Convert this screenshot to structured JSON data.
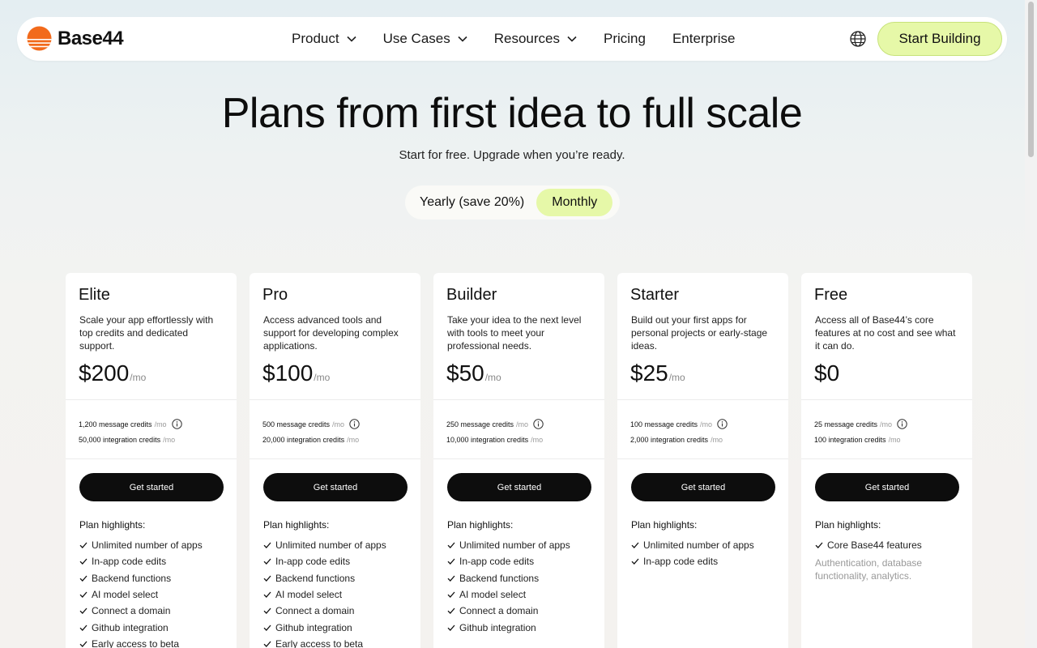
{
  "nav": {
    "brand": "Base44",
    "links": [
      {
        "label": "Product",
        "dropdown": true
      },
      {
        "label": "Use Cases",
        "dropdown": true
      },
      {
        "label": "Resources",
        "dropdown": true
      },
      {
        "label": "Pricing",
        "dropdown": false
      },
      {
        "label": "Enterprise",
        "dropdown": false
      }
    ],
    "cta": "Start Building",
    "cta_color": "#e6f8a8",
    "brand_color": "#f26a1b"
  },
  "hero": {
    "title": "Plans from first idea to full scale",
    "subtitle": "Start for free. Upgrade when you’re ready."
  },
  "billing_toggle": {
    "options": [
      "Yearly (save 20%)",
      "Monthly"
    ],
    "selected": "Monthly"
  },
  "plans": [
    {
      "name": "Elite",
      "description": "Scale your app effortlessly with top credits and dedicated support.",
      "price": "$200",
      "price_unit": "/mo",
      "message_credits": "1,200 message credits",
      "integration_credits": "50,000 integration credits",
      "credit_unit": "/mo",
      "button": "Get started",
      "highlights_title": "Plan highlights:",
      "highlights": [
        "Unlimited number of apps",
        "In-app code edits",
        "Backend functions",
        "AI model select",
        "Connect a domain",
        "Github integration",
        "Early access to beta"
      ],
      "note": ""
    },
    {
      "name": "Pro",
      "description": "Access advanced tools and support for developing complex applications.",
      "price": "$100",
      "price_unit": "/mo",
      "message_credits": "500 message credits",
      "integration_credits": "20,000 integration credits",
      "credit_unit": "/mo",
      "button": "Get started",
      "highlights_title": "Plan highlights:",
      "highlights": [
        "Unlimited number of apps",
        "In-app code edits",
        "Backend functions",
        "AI model select",
        "Connect a domain",
        "Github integration",
        "Early access to beta"
      ],
      "note": ""
    },
    {
      "name": "Builder",
      "description": "Take your idea to the next level with tools to meet your professional needs.",
      "price": "$50",
      "price_unit": "/mo",
      "message_credits": "250 message credits",
      "integration_credits": "10,000 integration credits",
      "credit_unit": "/mo",
      "button": "Get started",
      "highlights_title": "Plan highlights:",
      "highlights": [
        "Unlimited number of apps",
        "In-app code edits",
        "Backend functions",
        "AI model select",
        "Connect a domain",
        "Github integration"
      ],
      "note": ""
    },
    {
      "name": "Starter",
      "description": "Build out your first apps for personal projects or early-stage ideas.",
      "price": "$25",
      "price_unit": "/mo",
      "message_credits": "100 message credits",
      "integration_credits": "2,000 integration credits",
      "credit_unit": "/mo",
      "button": "Get started",
      "highlights_title": "Plan highlights:",
      "highlights": [
        "Unlimited number of apps",
        "In-app code edits"
      ],
      "note": ""
    },
    {
      "name": "Free",
      "description": "Access all of Base44’s core features at no cost and see what it can do.",
      "price": "$0",
      "price_unit": "",
      "message_credits": "25 message credits",
      "integration_credits": "100 integration credits",
      "credit_unit": "/mo",
      "button": "Get started",
      "highlights_title": "Plan highlights:",
      "highlights": [
        "Core Base44 features"
      ],
      "note": "Authentication, database functionality, analytics."
    }
  ]
}
